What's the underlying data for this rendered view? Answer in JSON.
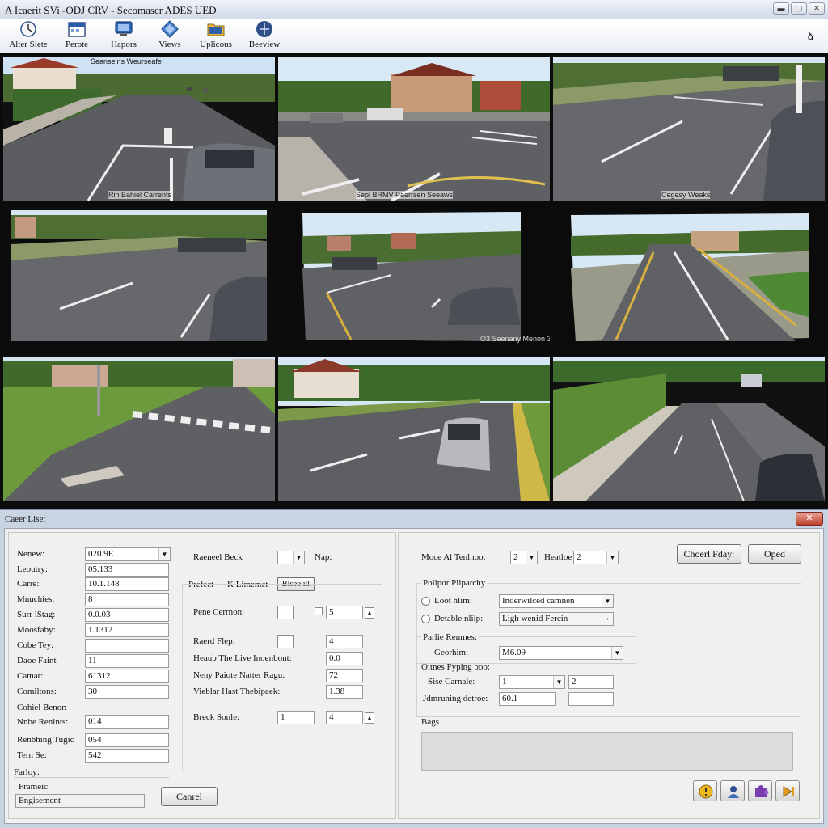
{
  "window": {
    "title": "A Icaerit SVi -ODJ CRV - Secomaser ADES UED",
    "min_glyph": "▬",
    "max_glyph": "▢",
    "close_glyph": "✕"
  },
  "toolbar": {
    "items": [
      {
        "label": "Alter Siete",
        "icon": "clock-icon"
      },
      {
        "label": "Perote",
        "icon": "calendar-icon"
      },
      {
        "label": "Hapors",
        "icon": "monitor-icon"
      },
      {
        "label": "Views",
        "icon": "diamond-icon"
      },
      {
        "label": "Uplicous",
        "icon": "folder-icon"
      },
      {
        "label": "Beeview",
        "icon": "globe-icon"
      }
    ],
    "right_glyph": "ձ"
  },
  "cameras": {
    "cam1_overlay": "Seanseins Weurseafe",
    "cam1_caption": "Rin Bahiel Carrents",
    "cam2_caption": "Sepl BRMV Paerrsen Seeaws",
    "cam3_caption": "Cegesy Weaks",
    "cam5_caption": "O3 Seenany Menon 3"
  },
  "dialog": {
    "title": "Caeer Lise:",
    "close_glyph": "✕",
    "left": {
      "rows": [
        {
          "label": "Nenew:",
          "value": "020.9E",
          "combo": true
        },
        {
          "label": "Leoutry:",
          "value": "05.133"
        },
        {
          "label": "Carre:",
          "value": "10.1.148"
        },
        {
          "label": "Mnuchies:",
          "value": "8"
        },
        {
          "label": "Surr lStag:",
          "value": "0.0.03"
        },
        {
          "label": "Moosfaby:",
          "value": "1.1312"
        },
        {
          "label": "Cobe Tey:",
          "value": ""
        },
        {
          "label": "Daoe Faint",
          "value": "11"
        },
        {
          "label": "Camar:",
          "value": "61312"
        },
        {
          "label": "Comiltons:",
          "value": "30"
        }
      ],
      "section_label": "Cohiel Benor:",
      "rows2": [
        {
          "label": "Nnbe Renints:",
          "value": "014"
        },
        {
          "label": "Renbhing Tugic",
          "value": "054"
        },
        {
          "label": "Tern Se:",
          "value": "542"
        }
      ],
      "bottom_label": "Farloy:",
      "list_items": [
        "Frameic",
        "Engisement"
      ],
      "cancel_button": "Canrel"
    },
    "middle": {
      "row1_label": "Raeneel Beck",
      "row1_value": "",
      "row1_suffix": "Nap:",
      "prefect_label": "Prefect",
      "prefect_value": "K Limemet",
      "prefect_button": "Blsoo.ill",
      "rows": [
        {
          "label": "Pene Cerrnon:",
          "value": "5"
        },
        {
          "label": "Raerd Flep:",
          "value": "4"
        },
        {
          "label": "Heaub The Live Inoenbont:",
          "value": "0.0"
        },
        {
          "label": "Neny Paiote Natter Ragu:",
          "value": "72"
        },
        {
          "label": "Vieblar Hast Thebipaek:",
          "value": "1.38"
        },
        {
          "label": "Breck Sonle:",
          "value": "4"
        }
      ],
      "breck_left_value": "1"
    },
    "right": {
      "mode_label": "Moce Al Tenlnoo:",
      "mode_value": "2",
      "heatlie_label": "Heatloe",
      "heatlie_value": "2",
      "chorl_button": "Choerl Fday:",
      "oped_button": "Oped",
      "group1_title": "Pollpor Pliparchy",
      "radio1_label": "Loot hlim:",
      "radio1_value": "Inderwilced camnen",
      "radio2_label": "Detable nliip:",
      "radio2_value": "Ligh wenid Fercin",
      "group2_title": "Parlie Renmes:",
      "georim_label": "Georhim:",
      "georim_value": "M6.09",
      "group3_title": "Oitnes Fyping boo:",
      "sise_label": "Sise Carnale:",
      "sise_value1": "1",
      "sise_value2": "2",
      "jdm_label": "Jdmruning detroe:",
      "jdm_value1": "60.1",
      "jdm_value2": "",
      "bags_label": "Bags"
    },
    "action_icons": [
      "warning-icon",
      "person-icon",
      "puzzle-icon",
      "forward-icon"
    ]
  }
}
